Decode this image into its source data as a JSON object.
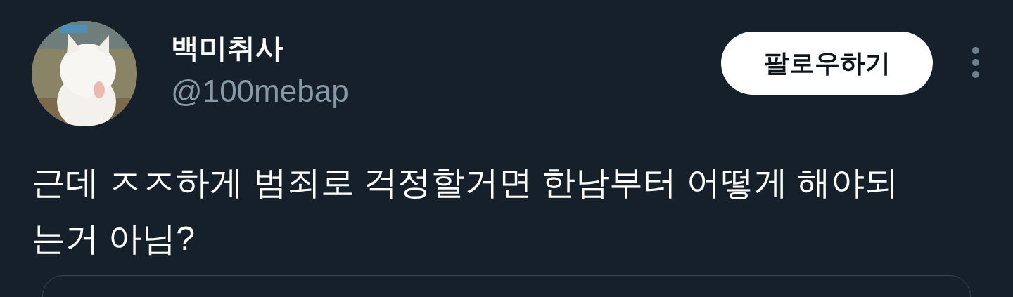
{
  "author": {
    "name": "백미취사",
    "handle": "@100mebap"
  },
  "follow_button": {
    "label": "팔로우하기"
  },
  "tweet": {
    "text": "근데 ㅈㅈ하게 범죄로 걱정할거면 한남부터 어떻게 해야되는거 아님?"
  }
}
